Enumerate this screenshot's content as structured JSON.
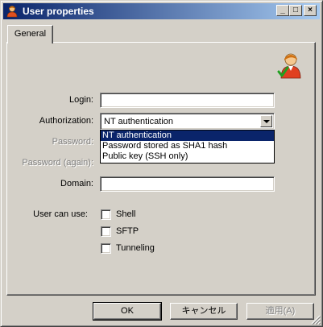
{
  "window": {
    "title": "User properties"
  },
  "titlebar_buttons": {
    "minimize": "_",
    "maximize": "□",
    "close": "×"
  },
  "tabs": [
    {
      "label": "General"
    }
  ],
  "form": {
    "login": {
      "label": "Login:",
      "value": ""
    },
    "authorization": {
      "label": "Authorization:",
      "selected": "NT authentication",
      "options": [
        "NT authentication",
        "Password stored as SHA1 hash",
        "Public key (SSH only)"
      ]
    },
    "password": {
      "label": "Password:"
    },
    "password_again": {
      "label": "Password (again):"
    },
    "domain": {
      "label": "Domain:",
      "value": ""
    },
    "user_can_use": {
      "label": "User can use:",
      "options": [
        {
          "label": "Shell",
          "checked": false
        },
        {
          "label": "SFTP",
          "checked": false
        },
        {
          "label": "Tunneling",
          "checked": false
        }
      ]
    }
  },
  "buttons": {
    "ok": "OK",
    "cancel": "キャンセル",
    "apply": "適用(A)"
  },
  "icons": {
    "app": "user-icon",
    "user": "user-check-icon"
  },
  "colors": {
    "title_bar": "#0a246a",
    "selection": "#0a246a",
    "face": "#d4d0c8"
  }
}
